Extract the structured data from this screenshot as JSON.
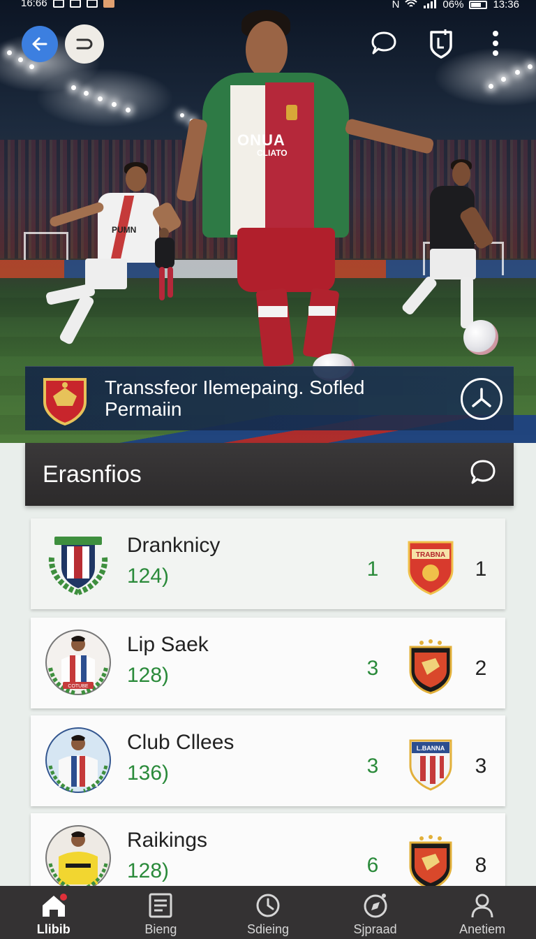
{
  "status_bar": {
    "time": "16:66",
    "battery": "06%",
    "clock": "13:36",
    "signal_letter": "N"
  },
  "hero": {
    "banner_title": "Transsfeor Ilemepaing. Sofled Permaiin",
    "player_shirt_text_1": "ONUA",
    "player_shirt_text_2": "CLIATO",
    "player_left_shirt_text": "PUMN"
  },
  "section": {
    "title": "Erasnfios"
  },
  "rows": [
    {
      "name": "Dranknicy",
      "sub": "124)",
      "count": "1",
      "rank": "1",
      "crest_label": "TRABNA"
    },
    {
      "name": "Lip Saek",
      "sub": "128)",
      "count": "3",
      "rank": "2",
      "avatar_label": "COTUBE"
    },
    {
      "name": "Club Cllees",
      "sub": "136)",
      "count": "3",
      "rank": "3",
      "crest_label": "L.BANNA"
    },
    {
      "name": "Raikings",
      "sub": "128)",
      "count": "6",
      "rank": "8"
    }
  ],
  "nav": [
    {
      "label": "Llibib",
      "icon": "home-icon",
      "active": true
    },
    {
      "label": "Bieng",
      "icon": "document-icon",
      "active": false
    },
    {
      "label": "Sdieing",
      "icon": "clock-icon",
      "active": false
    },
    {
      "label": "Sjpraad",
      "icon": "compass-icon",
      "active": false
    },
    {
      "label": "Anetiem",
      "icon": "profile-icon",
      "active": false
    }
  ],
  "colors": {
    "accent_blue": "#3c7fe0",
    "green_text": "#2a8a3a",
    "dark_header": "#2f2d2e",
    "banner_navy": "#162846",
    "nav_bg": "#343233"
  }
}
